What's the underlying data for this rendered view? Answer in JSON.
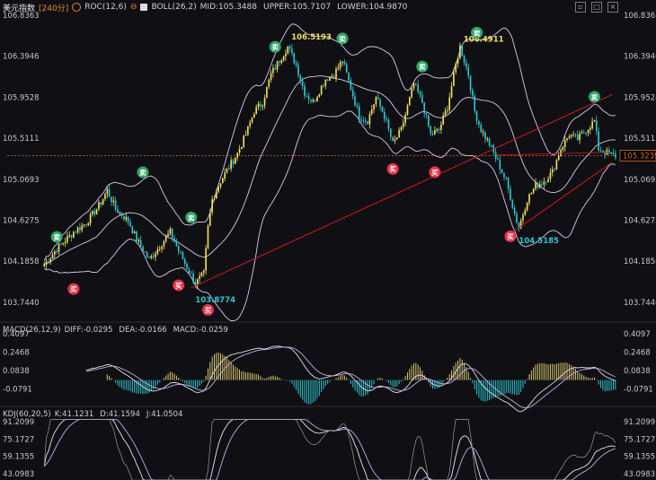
{
  "header": {
    "symbol": "美元指数",
    "period": "[240分]",
    "roc_label": "ROC(12,6)",
    "boll_label": "BOLL(26,2)",
    "mid": "MID:105.3488",
    "upper": "UPPER:105.7107",
    "lower": "LOWER:104.9870",
    "settings_icon": "circle-settings-icon",
    "boll_toggle_icon": "checkbox-icon"
  },
  "window_buttons": [
    "restore-icon",
    "maximize-icon",
    "close-icon"
  ],
  "colors": {
    "up": "#f0e060",
    "down": "#2ec8d0",
    "boll": "#d8c8f0",
    "trend": "#d01820",
    "buy": "#e8304a",
    "sell": "#2ea86a",
    "price": "#d87020"
  },
  "chart_data": [
    {
      "type": "candlestick",
      "title": "美元指数 240分",
      "ylim": [
        103.55,
        106.8363
      ],
      "y_ticks": [
        "106.8363",
        "106.3946",
        "105.9528",
        "105.5111",
        "105.0693",
        "104.6275",
        "104.1858",
        "103.7440"
      ],
      "current_price": "105.3239",
      "bollinger": {
        "mid": 105.3488,
        "upper": 105.7107,
        "lower": 104.987
      },
      "annotations": [
        {
          "label": "106.5193",
          "value": 106.5193
        },
        {
          "label": "106.4911",
          "value": 106.4911
        },
        {
          "label": "104.5185",
          "value": 104.5185
        },
        {
          "label": "103.8774",
          "value": 103.8774
        }
      ],
      "buy_label": "买",
      "sell_label": "卖",
      "buy_signals": 7,
      "sell_signals": 7
    },
    {
      "type": "bar",
      "title": "MACD(26,12,9)",
      "diff": "DIFF:-0.0295",
      "dea": "DEA:-0.0166",
      "macd": "MACD:-0.0259",
      "y_ticks": [
        "0.4097",
        "0.2468",
        "0.0838",
        "-0.0791"
      ],
      "ylim": [
        -0.17,
        0.4097
      ]
    },
    {
      "type": "line",
      "title": "KDJ(60,20,5)",
      "k": "K:41.1231",
      "d": "D:41.1594",
      "j": "J:41.0504",
      "y_ticks": [
        "91.2099",
        "75.1727",
        "59.1355",
        "43.0983"
      ],
      "ylim": [
        43.0983,
        91.2099
      ]
    }
  ]
}
